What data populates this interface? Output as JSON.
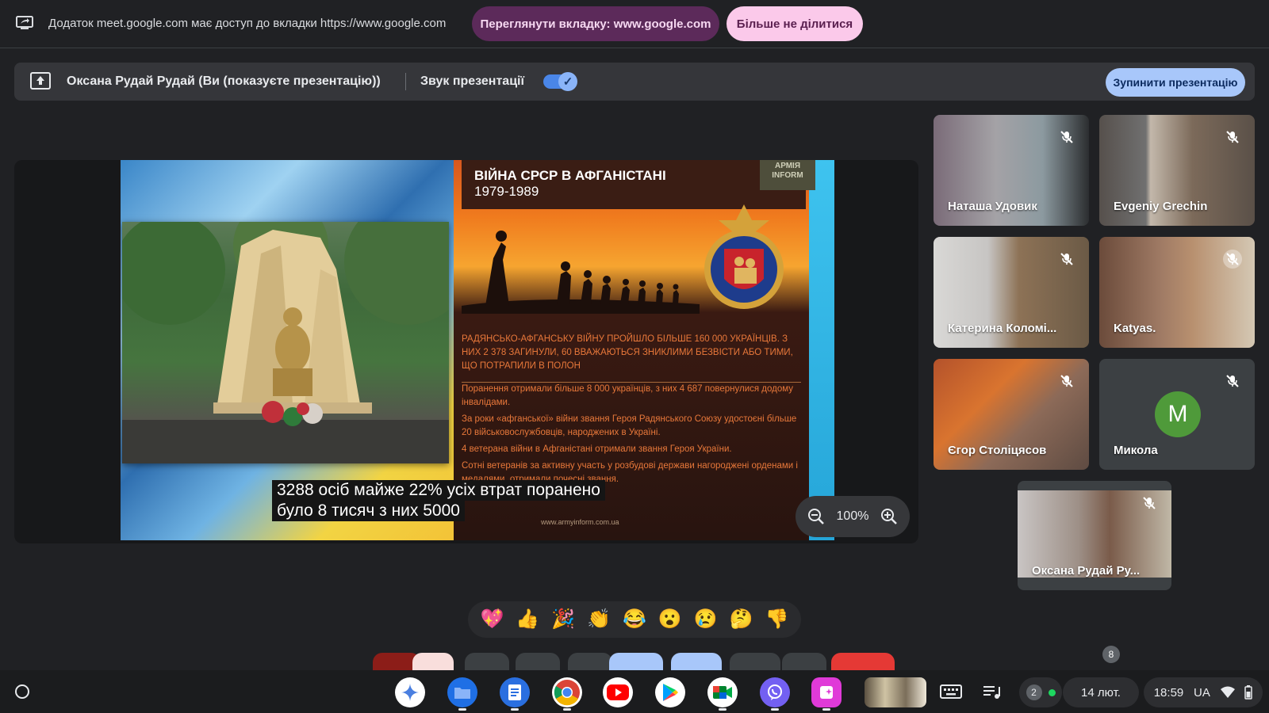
{
  "share_bar": {
    "text": "Додаток meet.google.com має доступ до вкладки https://www.google.com",
    "view_tab_button": "Переглянути вкладку: www.google.com",
    "stop_sharing_button": "Більше не ділитися"
  },
  "presenting_bar": {
    "presenter_text": "Оксана Рудай Рудай (Ви (показуєте презентацію))",
    "sound_label": "Звук презентації",
    "sound_enabled": true,
    "stop_button": "Зупинити презентацію"
  },
  "slide": {
    "title": "ВІЙНА СРСР В АФГАНІСТАНІ",
    "years": "1979-1989",
    "logo": "АРМІЯ INFORM",
    "para1": "РАДЯНСЬКО-АФГАНСЬКУ ВІЙНУ ПРОЙШЛО БІЛЬШЕ 160 000 УКРАЇНЦІВ. З НИХ 2 378 ЗАГИНУЛИ, 60 ВВАЖАЮТЬСЯ ЗНИКЛИМИ БЕЗВІСТИ АБО ТИМИ, ЩО ПОТРАПИЛИ В ПОЛОН",
    "para2": "Поранення отримали більше 8 000 українців, з них 4 687 повернулися додому інвалідами.",
    "para3": "За роки «афганської» війни звання Героя Радянського Союзу удостоєні більше 20 військовослужбовців, народжених в Україні.",
    "para4": "4 ветерана війни в Афганістані отримали звання Героя України.",
    "para5": "Сотні ветеранів за активну участь у розбудові держави нагороджені орденами і медалями, отримали почесні звання.",
    "url": "www.armyinform.com.ua"
  },
  "caption": {
    "line1": "3288 осіб майже 22% усіх втрат поранено",
    "line2": "було 8 тисяч з них 5000"
  },
  "zoom": {
    "level": "100%"
  },
  "participants": [
    {
      "name": "Наташа Удовик"
    },
    {
      "name": "Evgeniy Grechin"
    },
    {
      "name": "Катерина Коломі..."
    },
    {
      "name": "Katyas."
    },
    {
      "name": "Єгор Століцясов"
    },
    {
      "name": "Микола",
      "avatar_letter": "M",
      "avatar_color": "#4f9a3a"
    },
    {
      "name": "Оксана Рудай Ру..."
    }
  ],
  "reactions": [
    "💖",
    "👍",
    "🎉",
    "👏",
    "😂",
    "😮",
    "😢",
    "🤔",
    "👎"
  ],
  "control_bar": {
    "badge_count": "8"
  },
  "shelf": {
    "apps": [
      "gemini",
      "files",
      "docs",
      "chrome",
      "youtube",
      "play-store",
      "meet",
      "viber",
      "app-pink",
      "window-thumbnail"
    ],
    "notification_count": "2",
    "date": "14 лют.",
    "time": "18:59",
    "locale": "UA"
  }
}
